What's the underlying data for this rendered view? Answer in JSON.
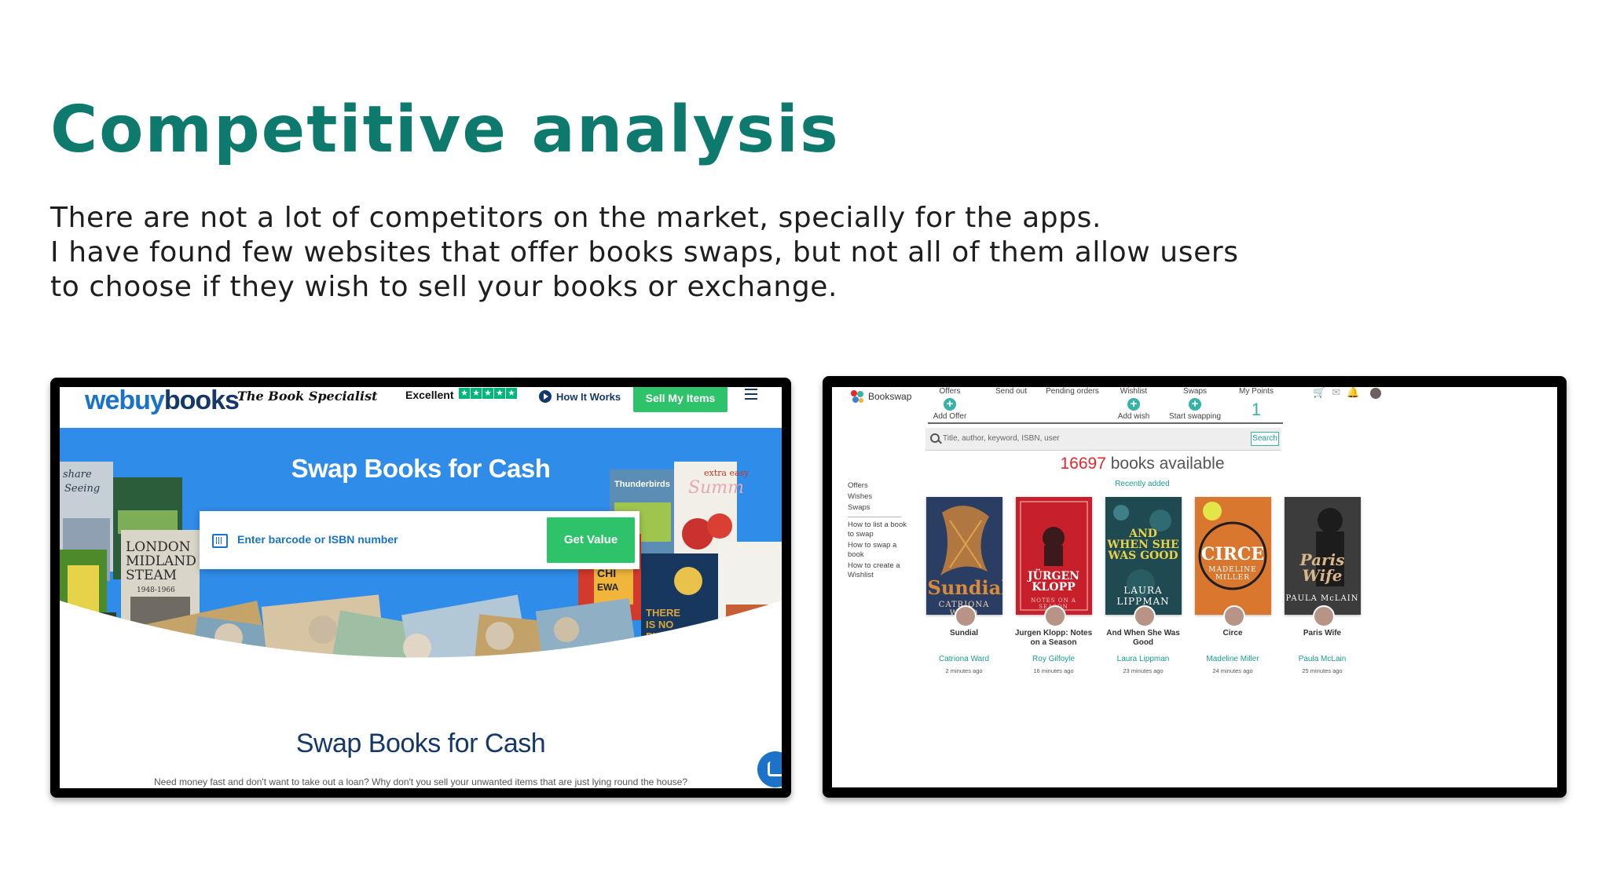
{
  "slide": {
    "title": "Competitive analysis",
    "intro_lines": [
      "There are not a lot of competitors on the market, specially for the apps.",
      "I have found few websites that offer books swaps, but not all of them allow users",
      "to choose if they wish to sell your books or exchange."
    ]
  },
  "webuybooks": {
    "logo_part1": "webuy",
    "logo_part2": "books",
    "tagline": "The Book Specialist",
    "trust_label": "Excellent",
    "trust_stars": 5,
    "how_it_works": "How It Works",
    "sell_button": "Sell My Items",
    "hero_title": "Swap Books for Cash",
    "search_placeholder": "Enter barcode or ISBN number",
    "get_value_button": "Get Value",
    "section_title": "Swap Books for Cash",
    "section_text": "Need money fast and don't want to take out a loan? Why don't you sell your unwanted items that are just lying round the house?",
    "colors": {
      "blue": "#1a73c9",
      "navy": "#15386b",
      "green": "#2ec26a",
      "trustpilot": "#00b67a"
    }
  },
  "bookswap": {
    "logo_text": "Bookswap",
    "nav": [
      {
        "label": "Offers",
        "action": "Add Offer"
      },
      {
        "label": "Send out"
      },
      {
        "label": "Pending orders"
      },
      {
        "label": "Wishlist",
        "action": "Add wish"
      },
      {
        "label": "Swaps",
        "action": "Start swapping"
      },
      {
        "label": "My Points",
        "value": "1"
      }
    ],
    "search_placeholder": "Title, author, keyword, ISBN, user",
    "search_button": "Search",
    "count_number": "16697",
    "count_text": "books available",
    "recently_added": "Recently added",
    "sidebar": {
      "items": [
        "Offers",
        "Wishes",
        "Swaps"
      ],
      "links": [
        "How to list a book to swap",
        "How to swap a book",
        "How to create a Wishlist"
      ]
    },
    "books": [
      {
        "title": "Sundial",
        "author": "Catriona Ward",
        "time": "2 minutes ago",
        "cover_title": "Sundial",
        "cover_author": "CATRIONA WARD"
      },
      {
        "title": "Jurgen Klopp: Notes on a Season",
        "author": "Roy Gilfoyle",
        "time": "16 minutes ago",
        "cover_title": "JÜRGEN KLOPP",
        "cover_author": "NOTES ON A SEASON"
      },
      {
        "title": "And When She Was Good",
        "author": "Laura Lippman",
        "time": "23 minutes ago",
        "cover_title": "AND WHEN SHE WAS GOOD",
        "cover_author": "LAURA LIPPMAN"
      },
      {
        "title": "Circe",
        "author": "Madeline Miller",
        "time": "24 minutes ago",
        "cover_title": "CIRCE",
        "cover_author": "MADELINE MILLER"
      },
      {
        "title": "Paris Wife",
        "author": "Paula McLain",
        "time": "25 minutes ago",
        "cover_title": "Paris Wife",
        "cover_author": "PAULA McLAIN"
      }
    ],
    "colors": {
      "teal": "#34b3a6",
      "count_red": "#e8262b"
    }
  }
}
